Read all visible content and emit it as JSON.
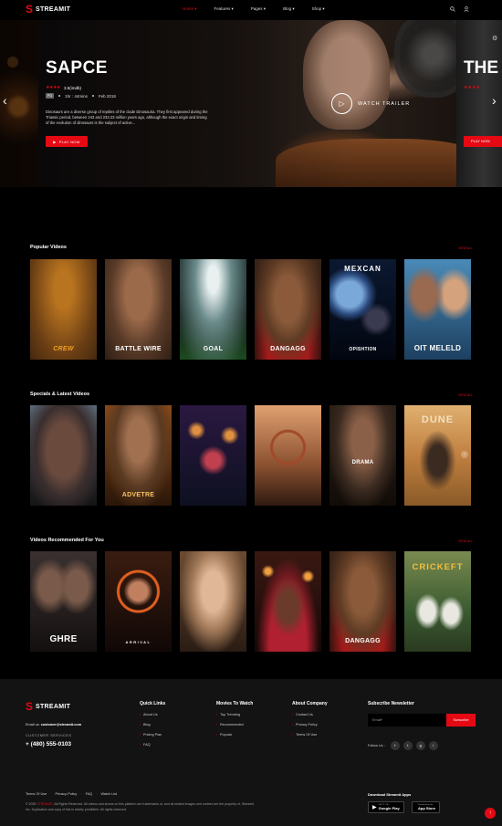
{
  "brand": {
    "name": "STREAMIT",
    "mark": "S"
  },
  "nav": {
    "items": [
      "Home ▾",
      "Features ▾",
      "Pages ▾",
      "Blog ▾",
      "Shop ▾"
    ]
  },
  "header_icons": [
    "search-icon",
    "user-icon"
  ],
  "hero": {
    "title": "SAPCE",
    "rating": "3.5(imdb)",
    "stars": "★★★★",
    "pg": "PG",
    "duration": "1hr : 44mins",
    "date": "Feb 2018",
    "description": "Dinosaurs are a diverse group of reptiles of the clade Dinosauria. They first appeared during the Triassic period, between 243 and 233.23 million years ago, although the exact origin and timing of the evolution of dinosaurs is the subject of active...",
    "play_label": "PLAY NOW",
    "trailer_label": "WATCH TRAILER",
    "next_title": "THE",
    "next_play_label": "PLAY NOW"
  },
  "sections": [
    {
      "title": "Popular Videos",
      "view_all": "VIEW ALL",
      "cards": [
        {
          "top": "",
          "caption": "CREW",
          "sub": ""
        },
        {
          "top": "",
          "caption": "BATTLE WIRE",
          "sub": ""
        },
        {
          "top": "",
          "caption": "GOAL",
          "sub": ""
        },
        {
          "top": "",
          "caption": "DANGAGG",
          "sub": ""
        },
        {
          "top": "MEXCAN",
          "caption": "OPISHTION",
          "sub": ""
        },
        {
          "top": "",
          "caption": "OIT MELELD",
          "sub": ""
        }
      ]
    },
    {
      "title": "Specials & Latest Videos",
      "view_all": "VIEW ALL",
      "cards": [
        {
          "top": "",
          "caption": "",
          "sub": ""
        },
        {
          "top": "",
          "caption": "ADVETRE",
          "sub": ""
        },
        {
          "top": "",
          "caption": "",
          "sub": ""
        },
        {
          "top": "",
          "caption": "",
          "sub": ""
        },
        {
          "top": "",
          "caption": "DRAMA",
          "sub": ""
        },
        {
          "top": "DUNE",
          "caption": "",
          "sub": ""
        }
      ]
    },
    {
      "title": "Videos Recommended For You",
      "view_all": "VIEW ALL",
      "cards": [
        {
          "top": "",
          "caption": "GHRE",
          "sub": ""
        },
        {
          "top": "",
          "caption": "ARRIVAL",
          "sub": ""
        },
        {
          "top": "",
          "caption": "",
          "sub": ""
        },
        {
          "top": "",
          "caption": "",
          "sub": ""
        },
        {
          "top": "",
          "caption": "DANGAGG",
          "sub": ""
        },
        {
          "top": "CRICKEFT",
          "caption": "",
          "sub": ""
        }
      ]
    }
  ],
  "footer": {
    "email_label": "Email us:",
    "email": "customer@streamit.com",
    "customer_services": "CUSTOMER SERVICES",
    "phone": "+ (480) 555-0103",
    "columns": [
      {
        "title": "Quick Links",
        "links": [
          "About Us",
          "Blog",
          "Pricing Plan",
          "FAQ"
        ]
      },
      {
        "title": "Movies To Watch",
        "links": [
          "Top Trending",
          "Recommended",
          "Popular"
        ]
      },
      {
        "title": "About Company",
        "links": [
          "Contact Us",
          "Privacy Policy",
          "Terms Of Use"
        ]
      }
    ],
    "newsletter_title": "Subscribe Newsletter",
    "newsletter_placeholder": "Email*",
    "subscribe_label": "Subscribe",
    "follow_label": "Follow Us :",
    "socials": [
      "f",
      "t",
      "g",
      "i"
    ],
    "bottom_links": [
      "Terms Of Use",
      "Privacy-Policy",
      "FAQ",
      "Watch List"
    ],
    "copyright_prefix": "© 2025",
    "copyright_brand": "STREAMIT",
    "copyright_text": ". All Rights Reserved. All videos and shows on this platform are trademarks of, and all related images and content are the property of, Streamit Inc. Duplication and copy of this is strictly prohibited. All rights reserved.",
    "apps_title": "Download Streamit Apps",
    "google_small": "GET IT ON",
    "google_label": "Google Play",
    "apple_small": "Download on the",
    "apple_label": "App Store"
  },
  "colors": {
    "accent": "#e50914",
    "background": "#000000",
    "footer": "#131313"
  }
}
